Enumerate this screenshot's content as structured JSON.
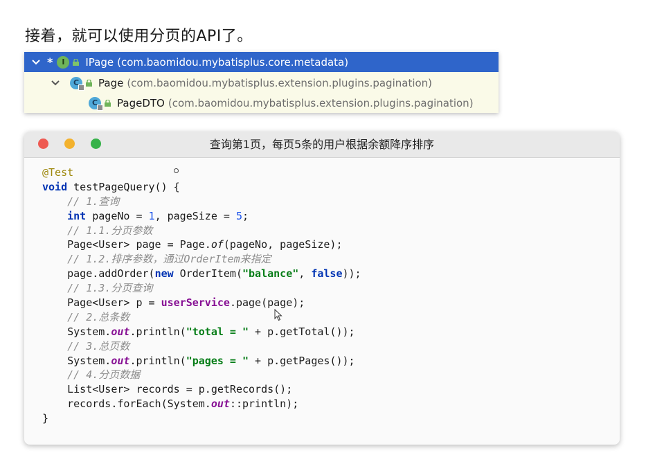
{
  "heading": "接着，就可以使用分页的API了。",
  "tree": {
    "rows": [
      {
        "name": "IPage",
        "pkg": "(com.baomidou.mybatisplus.core.metadata)",
        "icon": "I"
      },
      {
        "name": "Page",
        "pkg": "(com.baomidou.mybatisplus.extension.plugins.pagination)",
        "icon": "C"
      },
      {
        "name": "PageDTO",
        "pkg": "(com.baomidou.mybatisplus.extension.plugins.pagination)",
        "icon": "C"
      }
    ],
    "star": "*"
  },
  "window": {
    "title": "查询第1页，每页5条的用户根据余额降序排序"
  },
  "code": {
    "l1": {
      "ann": "@Test"
    },
    "l2": {
      "kw": "void",
      "rest": " testPageQuery() {"
    },
    "l3": {
      "indent": "    ",
      "cm": "// 1.查询"
    },
    "l4": {
      "indent": "    ",
      "kw": "int",
      "a": " pageNo = ",
      "n1": "1",
      "b": ", pageSize = ",
      "n2": "5",
      "c": ";"
    },
    "l5": {
      "indent": "    ",
      "cm": "// 1.1.分页参数"
    },
    "l6": {
      "indent": "    ",
      "a": "Page<User> page = Page.",
      "stat": "of",
      "b": "(pageNo, pageSize);"
    },
    "l7": {
      "indent": "    ",
      "cm": "// 1.2.排序参数，通过OrderItem来指定"
    },
    "l8": {
      "indent": "    ",
      "a": "page.addOrder(",
      "kw": "new",
      "b": " OrderItem(",
      "str": "\"balance\"",
      "c": ", ",
      "kw2": "false",
      "d": "));"
    },
    "l9": {
      "indent": "    ",
      "cm": "// 1.3.分页查询"
    },
    "l10": {
      "indent": "    ",
      "a": "Page<User> p = ",
      "svc": "userService",
      "b": ".page(page);"
    },
    "l11": {
      "indent": "    ",
      "cm": "// 2.总条数"
    },
    "l12": {
      "indent": "    ",
      "a": "System.",
      "fld": "out",
      "b": ".println(",
      "str": "\"total = \"",
      "c": " + p.getTotal());"
    },
    "l13": {
      "indent": "    ",
      "cm": "// 3.总页数"
    },
    "l14": {
      "indent": "    ",
      "a": "System.",
      "fld": "out",
      "b": ".println(",
      "str": "\"pages = \"",
      "c": " + p.getPages());"
    },
    "l15": {
      "indent": "    ",
      "cm": "// 4.分页数据"
    },
    "l16": {
      "indent": "    ",
      "a": "List<User> records = p.getRecords();"
    },
    "l17": {
      "indent": "    ",
      "a": "records.forEach(System.",
      "fld": "out",
      "b": "::println);"
    },
    "l18": {
      "a": "}"
    }
  }
}
